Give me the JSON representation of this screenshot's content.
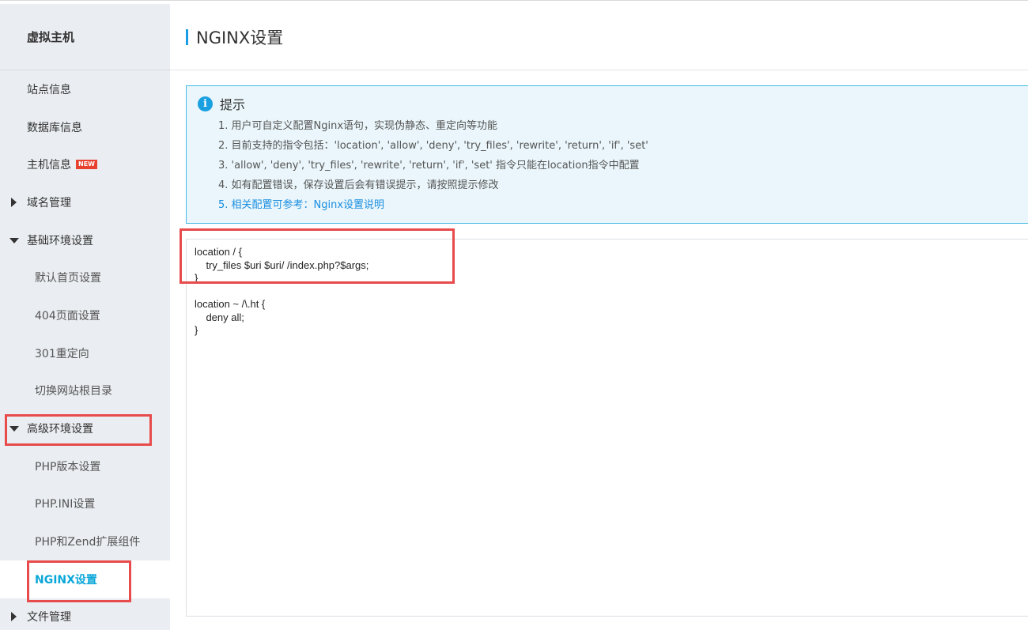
{
  "sidebar": {
    "title": "虚拟主机",
    "items": [
      {
        "label": "站点信息",
        "level": 0,
        "caret": "none"
      },
      {
        "label": "数据库信息",
        "level": 0,
        "caret": "none"
      },
      {
        "label": "主机信息",
        "level": 0,
        "caret": "none",
        "badge": "NEW"
      },
      {
        "label": "域名管理",
        "level": 0,
        "caret": "right"
      },
      {
        "label": "基础环境设置",
        "level": 0,
        "caret": "down"
      },
      {
        "label": "默认首页设置",
        "level": 1,
        "caret": "none"
      },
      {
        "label": "404页面设置",
        "level": 1,
        "caret": "none"
      },
      {
        "label": "301重定向",
        "level": 1,
        "caret": "none"
      },
      {
        "label": "切换网站根目录",
        "level": 1,
        "caret": "none"
      },
      {
        "label": "高级环境设置",
        "level": 0,
        "caret": "down"
      },
      {
        "label": "PHP版本设置",
        "level": 1,
        "caret": "none"
      },
      {
        "label": "PHP.INI设置",
        "level": 1,
        "caret": "none"
      },
      {
        "label": "PHP和Zend扩展组件",
        "level": 1,
        "caret": "none"
      },
      {
        "label": "NGINX设置",
        "level": 1,
        "caret": "none",
        "active": true
      },
      {
        "label": "文件管理",
        "level": 0,
        "caret": "right"
      }
    ]
  },
  "main": {
    "title": "NGINX设置",
    "tip": {
      "title": "提示",
      "icon": "info-icon",
      "items": [
        "1. 用户可自定义配置Nginx语句，实现伪静态、重定向等功能",
        "2. 目前支持的指令包括：'location', 'allow', 'deny', 'try_files', 'rewrite', 'return', 'if', 'set'",
        "3. 'allow', 'deny', 'try_files', 'rewrite', 'return', 'if', 'set' 指令只能在location指令中配置",
        "4. 如有配置错误，保存设置后会有错误提示，请按照提示修改",
        "5. 相关配置可参考：Nginx设置说明"
      ]
    },
    "editor_content": "location / {\n    try_files $uri $uri/ /index.php?$args;\n}\n\nlocation ~ /\\.ht {\n    deny all;\n}"
  },
  "colors": {
    "accent": "#0aa7d9",
    "highlight": "#e84b4b",
    "badge": "#e8412f",
    "tip_border": "#44bbe2",
    "tip_bg": "#eaf6fb",
    "sidebar_bg": "#eaedf1"
  }
}
